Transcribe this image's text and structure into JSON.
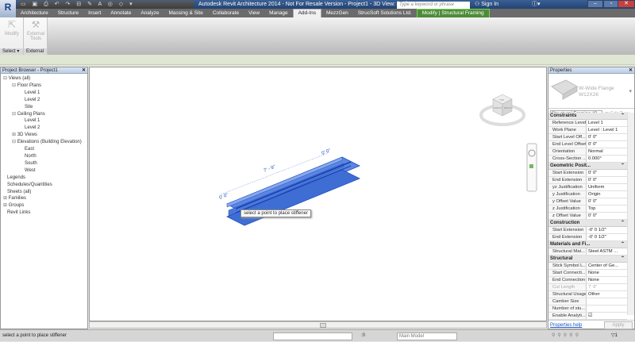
{
  "app": {
    "logo": "R",
    "title": "Autodesk Revit Architecture 2014 - Not For Resale Version -    Project1 - 3D View: {3D}",
    "search_placeholder": "Type a keyword or phrase",
    "sign_in": "Sign In",
    "window_buttons": [
      "minimize",
      "restore",
      "close"
    ]
  },
  "ribbon": {
    "tabs": [
      "Architecture",
      "Structure",
      "Insert",
      "Annotate",
      "Analyze",
      "Massing & Site",
      "Collaborate",
      "View",
      "Manage",
      "Add-Ins",
      "MezzGen",
      "StrucSoft Solutions Ltd.",
      "Modify | Structural Framing"
    ],
    "active_tab": "Add-Ins",
    "panels": [
      {
        "label": "Select ▾",
        "buttons": [
          "Modify"
        ]
      },
      {
        "label": "External",
        "buttons": [
          "External Tools"
        ]
      }
    ]
  },
  "browser": {
    "title": "Project Browser - Project1",
    "tree": [
      {
        "label": "Views (all)",
        "level": 0,
        "toggle": "⊟"
      },
      {
        "label": "Floor Plans",
        "level": 1,
        "toggle": "⊟"
      },
      {
        "label": "Level 1",
        "level": 2
      },
      {
        "label": "Level 2",
        "level": 2
      },
      {
        "label": "Site",
        "level": 2
      },
      {
        "label": "Ceiling Plans",
        "level": 1,
        "toggle": "⊟"
      },
      {
        "label": "Level 1",
        "level": 2
      },
      {
        "label": "Level 2",
        "level": 2
      },
      {
        "label": "3D Views",
        "level": 1,
        "toggle": "⊞"
      },
      {
        "label": "Elevations (Building Elevation)",
        "level": 1,
        "toggle": "⊟"
      },
      {
        "label": "East",
        "level": 2
      },
      {
        "label": "North",
        "level": 2
      },
      {
        "label": "South",
        "level": 2
      },
      {
        "label": "West",
        "level": 2
      },
      {
        "label": "Legends",
        "level": 0
      },
      {
        "label": "Schedules/Quantities",
        "level": 0
      },
      {
        "label": "Sheets (all)",
        "level": 0
      },
      {
        "label": "Families",
        "level": 0,
        "toggle": "⊞"
      },
      {
        "label": "Groups",
        "level": 0,
        "toggle": "⊞"
      },
      {
        "label": "Revit Links",
        "level": 0
      }
    ]
  },
  "viewport": {
    "dim_length": "7' - 9\"",
    "dim_start": "0' 0\"",
    "dim_end": "0' 0\"",
    "tooltip": "select a point to place stiffener",
    "viewcube": {
      "top": "TOP",
      "front": "FRONT",
      "right": "RIGHT"
    },
    "beam_color": "#3a6fd8"
  },
  "properties": {
    "title": "Properties",
    "type_family": "W-Wide Flange",
    "type_name": "W12X26",
    "filter": "Structural Framing (C",
    "edit_type": "Edit Type",
    "groups": [
      {
        "name": "Constraints",
        "rows": [
          [
            "Reference Level",
            "Level 1"
          ],
          [
            "Work Plane",
            "Level : Level 1"
          ],
          [
            "Start Level Off...",
            "0' 0\""
          ],
          [
            "End Level Offset",
            "0' 0\""
          ],
          [
            "Orientation",
            "Normal"
          ],
          [
            "Cross-Section ...",
            "0.000°"
          ]
        ]
      },
      {
        "name": "Geometric Posit...",
        "rows": [
          [
            "Start Extension",
            "0' 0\""
          ],
          [
            "End Extension",
            "0' 0\""
          ],
          [
            "yz Justification",
            "Uniform"
          ],
          [
            "y Justification",
            "Origin"
          ],
          [
            "y Offset Value",
            "0' 0\""
          ],
          [
            "z Justification",
            "Top"
          ],
          [
            "z Offset Value",
            "0' 0\""
          ]
        ]
      },
      {
        "name": "Construction",
        "rows": [
          [
            "Start Extension",
            "-0' 0 1/2\""
          ],
          [
            "End Extension",
            "-0' 0 1/2\""
          ]
        ]
      },
      {
        "name": "Materials and Fi...",
        "rows": [
          [
            "Structural Mat...",
            "Steel ASTM ..."
          ]
        ]
      },
      {
        "name": "Structural",
        "rows": [
          [
            "Stick Symbol L...",
            "Center of Ge..."
          ],
          [
            "Start Connecti...",
            "None"
          ],
          [
            "End Connection",
            "None"
          ],
          [
            "Cut Length",
            "7' 9\""
          ],
          [
            "Structural Usage",
            "Other"
          ],
          [
            "Camber Size",
            ""
          ],
          [
            "Number of stu...",
            ""
          ],
          [
            "Enable Analyti...",
            "☑"
          ]
        ]
      }
    ],
    "help": "Properties help",
    "apply": "Apply"
  },
  "status": {
    "text": "select a point to place stiffener",
    "workset_count": ":0",
    "model": "Main Model",
    "filter_count": "1"
  }
}
